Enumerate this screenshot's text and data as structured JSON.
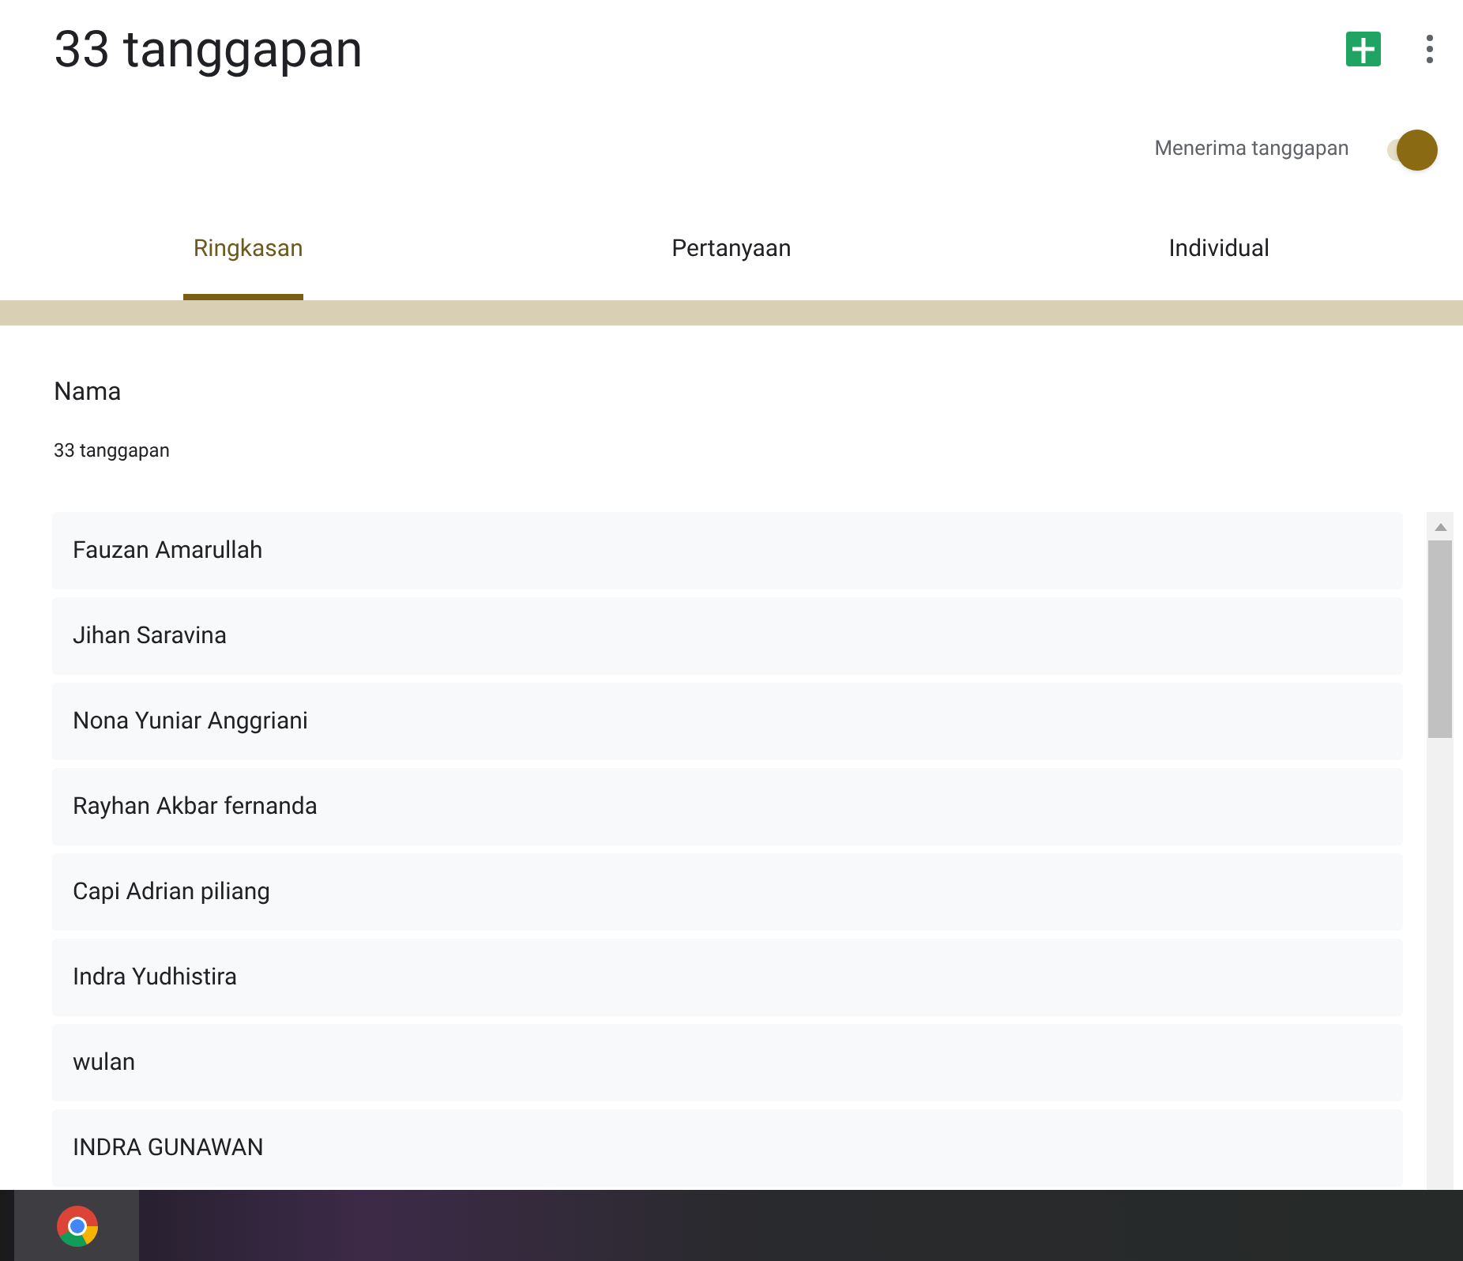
{
  "header": {
    "title": "33 tanggapan"
  },
  "accepting": {
    "label": "Menerima tanggapan",
    "on": true
  },
  "tabs": [
    {
      "label": "Ringkasan",
      "selected": true
    },
    {
      "label": "Pertanyaan",
      "selected": false
    },
    {
      "label": "Individual",
      "selected": false
    }
  ],
  "question": {
    "title": "Nama",
    "count": "33 tanggapan"
  },
  "answers": [
    "Fauzan Amarullah",
    "Jihan Saravina",
    "Nona Yuniar Anggriani",
    "Rayhan Akbar fernanda",
    "Capi Adrian piliang",
    "Indra Yudhistira",
    "wulan",
    "INDRA GUNAWAN"
  ]
}
